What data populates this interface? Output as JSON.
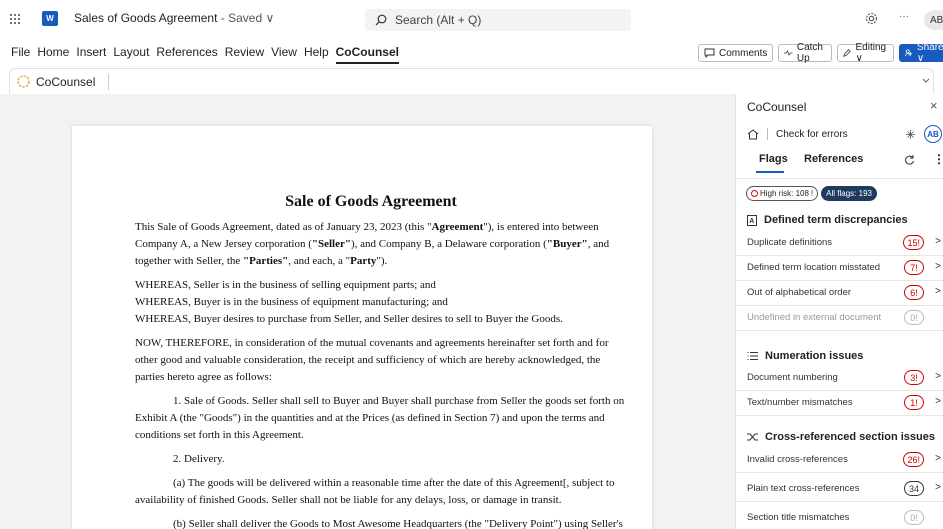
{
  "titlebar": {
    "doc_title": "Sales of Goods Agreement",
    "saved_status": " - Saved ∨",
    "search_placeholder": "Search (Alt + Q)",
    "more": "···",
    "avatar": "AB",
    "app_badge": "W"
  },
  "menu": {
    "items": [
      "File",
      "Home",
      "Insert",
      "Layout",
      "References",
      "Review",
      "View",
      "Help",
      "CoCounsel"
    ],
    "active": "CoCounsel"
  },
  "ribbon_buttons": {
    "comments": "Comments",
    "catch_up": "Catch Up",
    "editing": "Editing ∨",
    "share": "Share ∨"
  },
  "toolbar": {
    "cocounsel": "CoCounsel"
  },
  "document": {
    "title": "Sale of Goods Agreement",
    "p1_a": "This Sale of Goods Agreement, dated as of January 23, 2023 (this \"",
    "p1_b": "Agreement",
    "p1_c": "\"), is entered into between Company A, a New Jersey corporation (",
    "p1_d": "\"Seller\"",
    "p1_e": "), and Company B, a Delaware corporation (",
    "p1_f": "\"Buyer\"",
    "p1_g": ", and together with Seller, the ",
    "p1_h": "\"Parties\"",
    "p1_i": ", and each, a \"",
    "p1_j": "Party",
    "p1_k": "\").",
    "whereas1": "WHEREAS, Seller is in the business of selling equipment parts; and",
    "whereas2": "WHEREAS, Buyer is in the business of equipment manufacturing; and",
    "whereas3": "WHEREAS, Buyer desires to purchase from Seller, and Seller desires to sell to Buyer the Goods.",
    "now": "NOW, THEREFORE, in consideration of the mutual covenants and agreements hereinafter set forth and for other good and valuable consideration, the receipt and sufficiency of which are hereby acknowledged, the parties hereto agree as follows:",
    "s1": "1. Sale of Goods. Seller shall sell to Buyer and Buyer shall purchase from Seller the goods set forth on Exhibit A (the \"Goods\") in the quantities and at the Prices (as defined in Section 7) and upon the terms and conditions set forth in this Agreement.",
    "s2": "2. Delivery.",
    "s2a": "(a) The goods will be delivered within a reasonable time after the date of this Agreement[, subject to availability of finished Goods. Seller shall not be liable for any delays, loss, or damage in transit.",
    "s2b": "(b) Seller shall deliver the Goods to Most Awesome Headquarters (the \"Delivery Point\") using Seller's standard methods for packaging and shipping such Goods. Buyer shall take delivery of the Goods"
  },
  "panel": {
    "title": "CoCounsel",
    "check": "Check for errors",
    "avatar": "AB",
    "tabs": [
      "Flags",
      "References"
    ],
    "chip_high": "High risk: 108",
    "chip_all": "All flags: 193",
    "sections": [
      {
        "title": "Defined term discrepancies",
        "rows": [
          {
            "label": "Duplicate definitions",
            "count": "15",
            "style": "red"
          },
          {
            "label": "Defined term location misstated",
            "count": "7",
            "style": "red"
          },
          {
            "label": "Out of alphabetical order",
            "count": "6",
            "style": "red"
          },
          {
            "label": "Undefined in external document",
            "count": "0",
            "style": "light"
          }
        ]
      },
      {
        "title": "Numeration issues",
        "rows": [
          {
            "label": "Document numbering",
            "count": "3",
            "style": "red"
          },
          {
            "label": "Text/number mismatches",
            "count": "1",
            "style": "red"
          }
        ]
      },
      {
        "title": "Cross-referenced section issues",
        "rows": [
          {
            "label": "Invalid cross-references",
            "count": "26",
            "style": "red"
          },
          {
            "label": "Plain text cross-references",
            "count": "34",
            "style": "gray"
          },
          {
            "label": "Section title mismatches",
            "count": "0",
            "style": "light"
          }
        ]
      }
    ]
  },
  "colors": {
    "brand_blue": "#185abd",
    "risk_red": "#cc0000",
    "canvas_gray": "#f3f2f1"
  }
}
